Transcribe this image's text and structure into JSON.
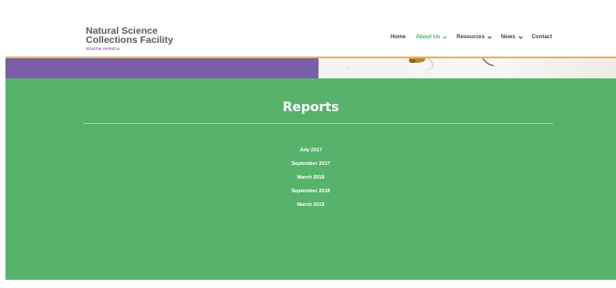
{
  "logo": {
    "line1": "Natural Science",
    "line2": "Collections Facility",
    "subtitle": "SOUTH AFRICA"
  },
  "nav": {
    "items": [
      {
        "label": "Home",
        "active": false,
        "dropdown": false
      },
      {
        "label": "About Us",
        "active": true,
        "dropdown": true
      },
      {
        "label": "Resources",
        "active": false,
        "dropdown": true
      },
      {
        "label": "News",
        "active": false,
        "dropdown": true
      },
      {
        "label": "Contact",
        "active": false,
        "dropdown": false
      }
    ]
  },
  "main": {
    "title": "Reports",
    "reports": [
      "July 2017",
      "September 2017",
      "March 2018",
      "September 2018",
      "March 2019"
    ]
  },
  "colors": {
    "brand_green": "#57b36b",
    "brand_purple": "#7a5ea8",
    "accent_orange": "#e9b35a",
    "nav_active": "#4db36b",
    "nav_text": "#3d4650"
  }
}
